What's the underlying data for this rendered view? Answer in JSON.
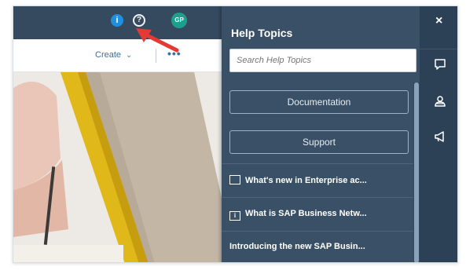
{
  "shell": {
    "info_icon": "info-icon",
    "help_icon": "help-circle-icon",
    "avatar_initials": "GP"
  },
  "toolbar": {
    "create_label": "Create",
    "more_label": "•••"
  },
  "help_panel": {
    "title": "Help Topics",
    "search_placeholder": "Search Help Topics",
    "buttons": [
      {
        "label": "Documentation"
      },
      {
        "label": "Support"
      }
    ],
    "links": [
      {
        "icon": "window-icon",
        "label": "What's new in Enterprise ac..."
      },
      {
        "icon": "info-box-icon",
        "label": "What is SAP Business Netw..."
      },
      {
        "icon": "",
        "label": "Introducing the new SAP Busin..."
      }
    ]
  },
  "rail": {
    "close_label": "×",
    "icons": [
      "chat-icon",
      "people-icon",
      "megaphone-icon"
    ]
  },
  "colors": {
    "shellbar": "#354a5f",
    "panel": "#3a5066",
    "rail": "#2c4156",
    "accent_red": "#e53935"
  }
}
